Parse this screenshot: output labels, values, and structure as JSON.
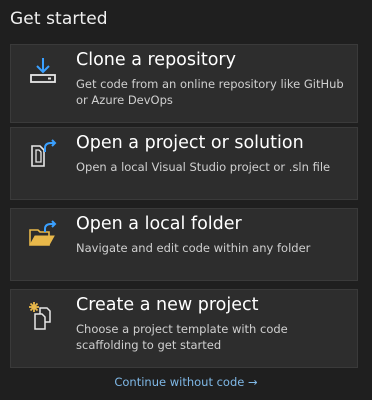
{
  "header": {
    "title": "Get started"
  },
  "cards": [
    {
      "label": "Clone a repository",
      "description": "Get code from an online repository like GitHub or Azure DevOps",
      "icon": "download-icon"
    },
    {
      "label": "Open a project or solution",
      "description": "Open a local Visual Studio project or .sln file",
      "icon": "open-project-icon"
    },
    {
      "label": "Open a local folder",
      "description": "Navigate and edit code within any folder",
      "icon": "open-folder-icon"
    },
    {
      "label": "Create a new project",
      "description": "Choose a project template with code scaffolding to get started",
      "icon": "new-project-icon"
    }
  ],
  "footer": {
    "continue_label": "Continue without code →"
  },
  "colors": {
    "background": "#1f1f1f",
    "card": "#2d2d2d",
    "accent": "#1e90ff",
    "link": "#7fb8e6",
    "folder": "#e8b84a"
  }
}
